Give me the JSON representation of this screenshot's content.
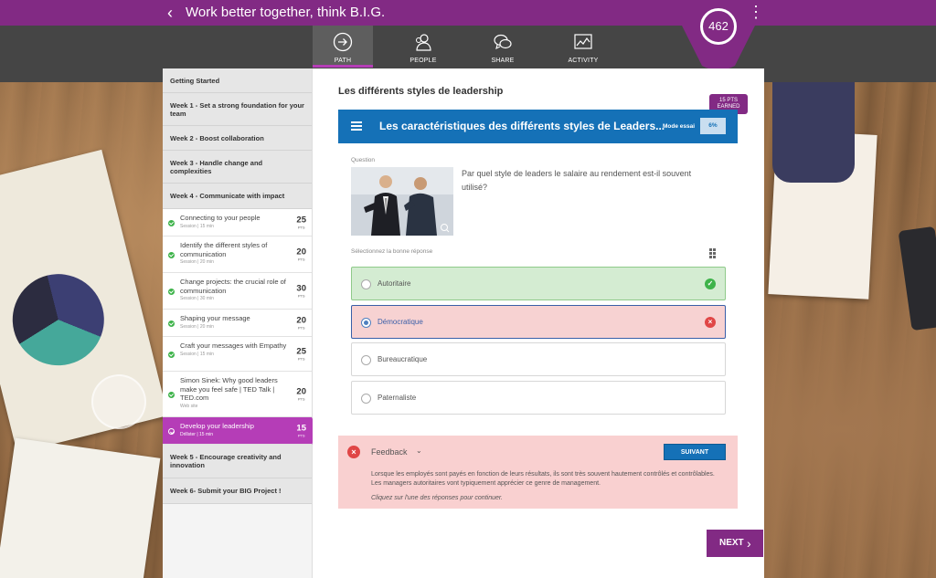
{
  "app": {
    "back_glyph": "‹",
    "title": "Work better together, think B.I.G.",
    "more_glyph": "⋮",
    "score": "462"
  },
  "nav": {
    "tabs": [
      {
        "label": "PATH",
        "icon": "arrow-circle-icon",
        "active": true
      },
      {
        "label": "PEOPLE",
        "icon": "people-icon"
      },
      {
        "label": "SHARE",
        "icon": "chat-bubbles-icon"
      },
      {
        "label": "ACTIVITY",
        "icon": "activity-chart-icon"
      }
    ]
  },
  "sidebar": {
    "getting_started": "Getting Started",
    "week1": "Week 1 - Set a strong foundation for your team",
    "week2": "Week 2 - Boost collaboration",
    "week3": "Week 3 - Handle change and complexities",
    "week4": "Week 4 - Communicate with impact",
    "sessions": [
      {
        "title": "Connecting to your people",
        "meta": "Session | 15 min",
        "pts": "25",
        "unit": "PTS"
      },
      {
        "title": "Identify the different styles of communication",
        "meta": "Session | 20 min",
        "pts": "20",
        "unit": "PTS"
      },
      {
        "title": "Change projects: the crucial role of communication",
        "meta": "Session | 30 min",
        "pts": "30",
        "unit": "PTS"
      },
      {
        "title": "Shaping your message",
        "meta": "Session | 20 min",
        "pts": "20",
        "unit": "PTS"
      },
      {
        "title": "Craft your messages with Empathy",
        "meta": "Session | 15 min",
        "pts": "25",
        "unit": "PTS"
      },
      {
        "title": "Simon Sinek: Why good leaders make you feel safe | TED Talk | TED.com",
        "meta": "Web site",
        "pts": "20",
        "unit": "PTS"
      },
      {
        "title": "Develop your leadership",
        "meta": "Drillster | 15 min",
        "pts": "15",
        "unit": "PTS",
        "active": true
      }
    ],
    "week5": "Week 5 - Encourage creativity and innovation",
    "week6": "Week 6- Submit your BIG Project !"
  },
  "lesson": {
    "title": "Les différents styles de leadership",
    "earned_pts": "15 PTS",
    "earned_label": "EARNED"
  },
  "quiz": {
    "title": "Les caractéristiques des différents styles de Leaders...",
    "mode": "Mode essai",
    "progress": "6%",
    "question_label": "Question",
    "question": "Par quel style de leaders le salaire au rendement est-il souvent utilisé?",
    "instruction": "Sélectionnez la bonne réponse",
    "options": [
      {
        "label": "Autoritaire",
        "state": "correct"
      },
      {
        "label": "Démocratique",
        "state": "wrong"
      },
      {
        "label": "Bureaucratique",
        "state": "none"
      },
      {
        "label": "Paternaliste",
        "state": "none"
      }
    ]
  },
  "feedback": {
    "title": "Feedback",
    "button": "SUIVANT",
    "body": "Lorsque les employés sont payés en fonction de leurs résultats, ils sont très souvent hautement contrôlés et contrôlables. Les managers autoritaires vont typiquement apprécier ce genre de management.",
    "note": "Cliquez sur l'une des réponses pour continuer."
  },
  "footer": {
    "next": "NEXT",
    "next_glyph": "›"
  },
  "colors": {
    "brand_purple": "#822a84",
    "accent_magenta": "#b53db7",
    "quiz_blue": "#1571b7",
    "correct_green": "#3eb34a",
    "wrong_red": "#e04646"
  }
}
